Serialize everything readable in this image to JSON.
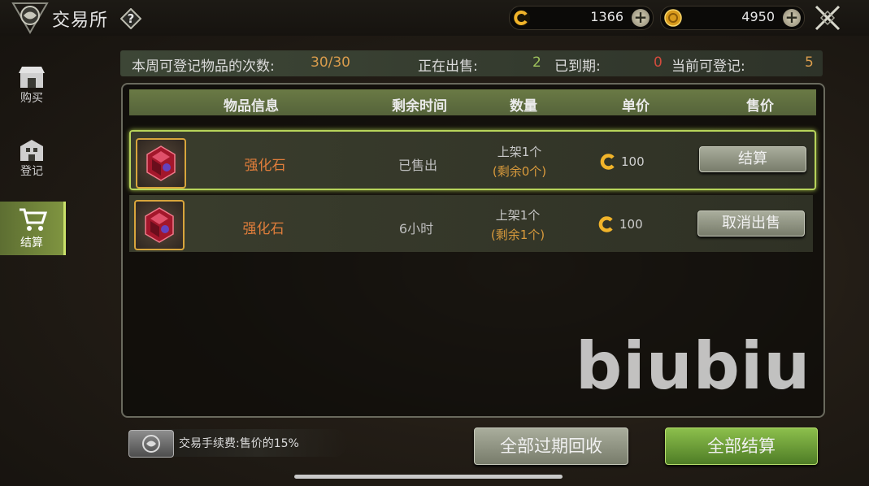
{
  "header": {
    "title": "交易所",
    "help_label": "?",
    "currencies": [
      {
        "name": "coin-icon",
        "value": "1366"
      },
      {
        "name": "gold-icon",
        "value": "4950"
      }
    ]
  },
  "sidebar": {
    "items": [
      {
        "label": "购买",
        "icon": "shop-icon",
        "active": false
      },
      {
        "label": "登记",
        "icon": "building-icon",
        "active": false
      },
      {
        "label": "结算",
        "icon": "cart-icon",
        "active": true
      }
    ]
  },
  "stats": {
    "weekly_label": "本周可登记物品的次数:",
    "weekly_value": "30/30",
    "selling_label": "正在出售:",
    "selling_value": "2",
    "expired_label": "已到期:",
    "expired_value": "0",
    "available_label": "当前可登记:",
    "available_value": "5"
  },
  "table": {
    "headers": [
      "物品信息",
      "剩余时间",
      "数量",
      "单价",
      "售价"
    ],
    "rows": [
      {
        "item": "强化石",
        "time": "已售出",
        "qty_line1": "上架1个",
        "qty_line2": "(剩余0个)",
        "price": "100",
        "action": "结算",
        "selected": true
      },
      {
        "item": "强化石",
        "time": "6小时",
        "qty_line1": "上架1个",
        "qty_line2": "(剩余1个)",
        "price": "100",
        "action": "取消出售",
        "selected": false
      }
    ]
  },
  "watermark": "biubiu",
  "footer": {
    "fee_text": "交易手续费:售价的15%",
    "reclaim_label": "全部过期回收",
    "settle_all_label": "全部结算"
  },
  "colors": {
    "accent_green": "#8cbf4c",
    "item_name": "#e07d3b",
    "highlight_orange": "#d99c4c",
    "expired_red": "#d24b3d"
  }
}
